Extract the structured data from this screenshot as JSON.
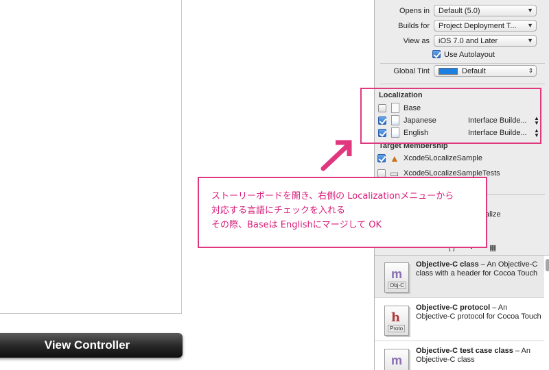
{
  "canvas": {
    "view_controller_label": "View Controller"
  },
  "document": {
    "opens_in": {
      "label": "Opens in",
      "value": "Default (5.0)"
    },
    "builds_for": {
      "label": "Builds for",
      "value": "Project Deployment T..."
    },
    "view_as": {
      "label": "View as",
      "value": "iOS 7.0 and Later"
    },
    "use_autolayout": {
      "label": "Use Autolayout",
      "checked": true
    },
    "global_tint": {
      "label": "Global Tint",
      "value": "Default",
      "color": "#1d7fe0"
    }
  },
  "localization": {
    "title": "Localization",
    "rows": [
      {
        "name": "Base",
        "checked": false,
        "type": ""
      },
      {
        "name": "Japanese",
        "checked": true,
        "type": "Interface Builde..."
      },
      {
        "name": "English",
        "checked": true,
        "type": "Interface Builde..."
      }
    ]
  },
  "target_membership": {
    "title": "Target Membership",
    "rows": [
      {
        "name": "Xcode5LocalizeSample",
        "checked": true,
        "icon": "app-target-icon"
      },
      {
        "name": "Xcode5LocalizeSampleTests",
        "checked": false,
        "icon": "test-bundle-icon"
      }
    ]
  },
  "library": {
    "partial_label": "alize",
    "tabs": [
      "file-template-icon",
      "code-snippet-icon",
      "object-icon",
      "media-icon"
    ],
    "tab_glyphs": {
      "code": "{ }"
    },
    "templates": [
      {
        "title": "Objective-C class",
        "desc": " – An Objective-C class with a header for Cocoa Touch",
        "tag": "Obj-C",
        "glyph": "m",
        "selected": true
      },
      {
        "title": "Objective-C protocol",
        "desc": " – An Objective-C protocol for Cocoa Touch",
        "tag": "Proto",
        "glyph": "h",
        "selected": false
      },
      {
        "title": "Objective-C test case class",
        "desc": " – An Objective-C class",
        "tag": "",
        "glyph": "m",
        "selected": false
      }
    ]
  },
  "annotation": {
    "accent": "#e0387f",
    "lines": [
      "ストーリーボードを開き、右側の Localizationメニューから",
      "対応する言語にチェックを入れる",
      "その際、Baseは Englishにマージして OK"
    ]
  }
}
